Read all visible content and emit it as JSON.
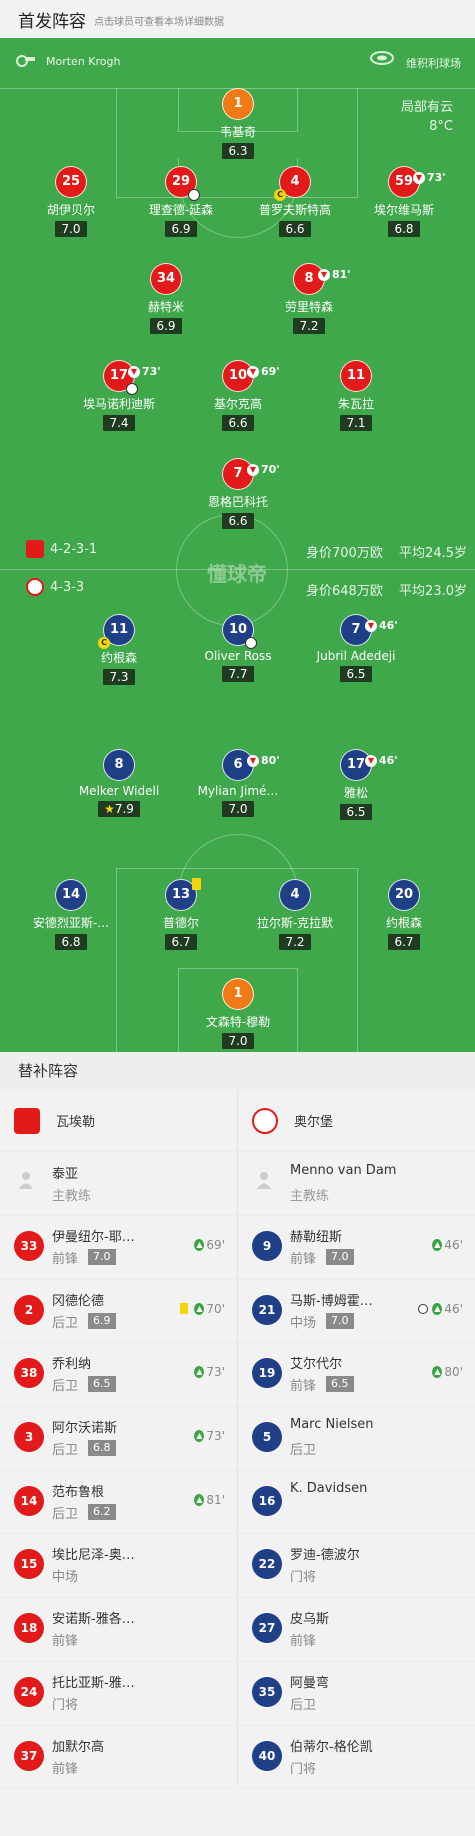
{
  "header": {
    "title": "首发阵容",
    "subtitle": "点击球员可查看本场详细数据"
  },
  "match": {
    "referee": "Morten Krogh",
    "venue": "维积利球场",
    "weather": "局部有云",
    "temperature": "8°C",
    "logo_text": "懂球帝"
  },
  "home": {
    "name": "瓦埃勒",
    "formation": "4-2-3-1",
    "value": "身价700万欧",
    "avg_age": "平均24.5岁",
    "color": "#e21a1a",
    "lineup": [
      {
        "number": "1",
        "name": "韦基奇",
        "rating": "6.3"
      },
      {
        "number": "25",
        "name": "胡伊贝尔",
        "rating": "7.0"
      },
      {
        "number": "29",
        "name": "理查德-延森",
        "rating": "6.9"
      },
      {
        "number": "4",
        "name": "普罗夫斯特高",
        "rating": "6.6"
      },
      {
        "number": "59",
        "name": "埃尔维马斯",
        "rating": "6.8",
        "sub_time": "73'"
      },
      {
        "number": "34",
        "name": "赫特米",
        "rating": "6.9"
      },
      {
        "number": "8",
        "name": "劳里特森",
        "rating": "7.2",
        "sub_time": "81'"
      },
      {
        "number": "17",
        "name": "埃马诺利迪斯",
        "rating": "7.4",
        "sub_time": "73'"
      },
      {
        "number": "10",
        "name": "基尔克高",
        "rating": "6.6",
        "sub_time": "69'"
      },
      {
        "number": "11",
        "name": "朱瓦拉",
        "rating": "7.1"
      },
      {
        "number": "7",
        "name": "恩格巴科托",
        "rating": "6.6",
        "sub_time": "70'"
      }
    ],
    "coach": {
      "name": "泰亚",
      "role": "主教练"
    },
    "subs": [
      {
        "number": "33",
        "name": "伊曼纽尔-耶…",
        "position": "前锋",
        "rating": "7.0",
        "time": "69'"
      },
      {
        "number": "2",
        "name": "冈德伦德",
        "position": "后卫",
        "rating": "6.9",
        "time": "70'"
      },
      {
        "number": "38",
        "name": "乔利纳",
        "position": "后卫",
        "rating": "6.5",
        "time": "73'"
      },
      {
        "number": "3",
        "name": "阿尔沃诺斯",
        "position": "后卫",
        "rating": "6.8",
        "time": "73'"
      },
      {
        "number": "14",
        "name": "范布鲁根",
        "position": "后卫",
        "rating": "6.2",
        "time": "81'"
      },
      {
        "number": "15",
        "name": "埃比尼泽-奥…",
        "position": "中场"
      },
      {
        "number": "18",
        "name": "安诺斯-雅各…",
        "position": "前锋"
      },
      {
        "number": "24",
        "name": "托比亚斯-雅…",
        "position": "门将"
      },
      {
        "number": "37",
        "name": "加默尔高",
        "position": "前锋"
      }
    ]
  },
  "away": {
    "name": "奥尔堡",
    "formation": "4-3-3",
    "value": "身价648万欧",
    "avg_age": "平均23.0岁",
    "color": "#1f3f86",
    "lineup": [
      {
        "number": "11",
        "name": "约根森",
        "rating": "7.3"
      },
      {
        "number": "10",
        "name": "Oliver Ross",
        "rating": "7.7"
      },
      {
        "number": "7",
        "name": "Jubril Adedeji",
        "rating": "6.5",
        "sub_time": "46'"
      },
      {
        "number": "8",
        "name": "Melker Widell",
        "rating": "7.9"
      },
      {
        "number": "6",
        "name": "Mylian Jimé…",
        "rating": "7.0",
        "sub_time": "80'"
      },
      {
        "number": "17",
        "name": "雅松",
        "rating": "6.5",
        "sub_time": "46'"
      },
      {
        "number": "14",
        "name": "安德烈亚斯-…",
        "rating": "6.8"
      },
      {
        "number": "13",
        "name": "普德尔",
        "rating": "6.7"
      },
      {
        "number": "4",
        "name": "拉尔斯-克拉默",
        "rating": "7.2"
      },
      {
        "number": "20",
        "name": "约根森",
        "rating": "6.7"
      },
      {
        "number": "1",
        "name": "文森特-穆勒",
        "rating": "7.0"
      }
    ],
    "coach": {
      "name": "Menno van Dam",
      "role": "主教练"
    },
    "subs": [
      {
        "number": "9",
        "name": "赫勒纽斯",
        "position": "前锋",
        "rating": "7.0",
        "time": "46'"
      },
      {
        "number": "21",
        "name": "马斯-博姆霍…",
        "position": "中场",
        "rating": "7.0",
        "time": "46'"
      },
      {
        "number": "19",
        "name": "艾尔代尔",
        "position": "前锋",
        "rating": "6.5",
        "time": "80'"
      },
      {
        "number": "5",
        "name": "Marc Nielsen",
        "position": "后卫"
      },
      {
        "number": "16",
        "name": "K. Davidsen",
        "position": ""
      },
      {
        "number": "22",
        "name": "罗迪-德波尔",
        "position": "门将"
      },
      {
        "number": "27",
        "name": "皮乌斯",
        "position": "前锋"
      },
      {
        "number": "35",
        "name": "阿曼弯",
        "position": "后卫"
      },
      {
        "number": "40",
        "name": "伯蒂尔-格伦凯",
        "position": "门将"
      }
    ]
  },
  "subs_title": "替补阵容",
  "icons": {
    "whistle": "whistle-icon",
    "stadium": "stadium-icon",
    "ball": "ball-icon",
    "captain": "captain-icon",
    "sub_out": "sub-out-icon",
    "sub_in": "sub-in-icon",
    "yellow_card": "yellow-card-icon",
    "star": "star-icon"
  }
}
